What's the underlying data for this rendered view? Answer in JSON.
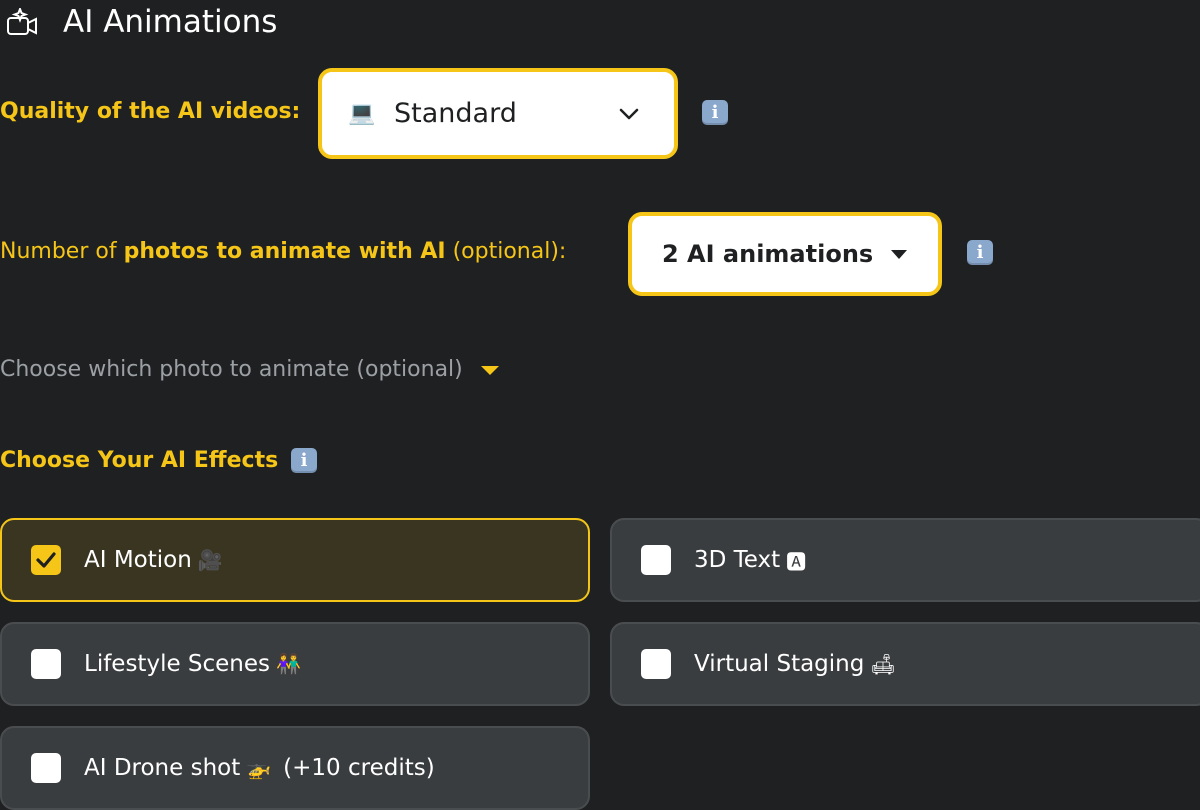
{
  "header": {
    "title": "AI Animations",
    "icon": "sparkle-video-icon"
  },
  "quality": {
    "label_bold": "Quality",
    "label_rest": " of the AI videos:",
    "selected": "Standard",
    "emoji": "💻",
    "icon": "laptop-icon"
  },
  "animations": {
    "label_pre": "Number of ",
    "label_bold": "photos to animate with AI",
    "label_post": " (optional):",
    "selected": "2 AI animations"
  },
  "choose_photo": {
    "label": "Choose which photo to animate (optional)"
  },
  "effects": {
    "title": "Choose Your AI Effects",
    "items": [
      {
        "label": "AI Motion",
        "emoji": "🎥",
        "suffix": "",
        "checked": true
      },
      {
        "label": "3D Text",
        "emoji": "🅰",
        "suffix": "",
        "checked": false
      },
      {
        "label": "Lifestyle Scenes",
        "emoji": "👫",
        "suffix": "",
        "checked": false
      },
      {
        "label": "Virtual Staging",
        "emoji": "🛋",
        "suffix": "",
        "checked": false
      },
      {
        "label": "AI Drone shot",
        "emoji": "🚁",
        "suffix": "(+10 credits)",
        "checked": false
      }
    ]
  },
  "colors": {
    "background": "#1e2021",
    "accent": "#f5c518",
    "card": "#3a3d3f",
    "card_checked": "#3a3521",
    "info": "#8aa7cc"
  }
}
